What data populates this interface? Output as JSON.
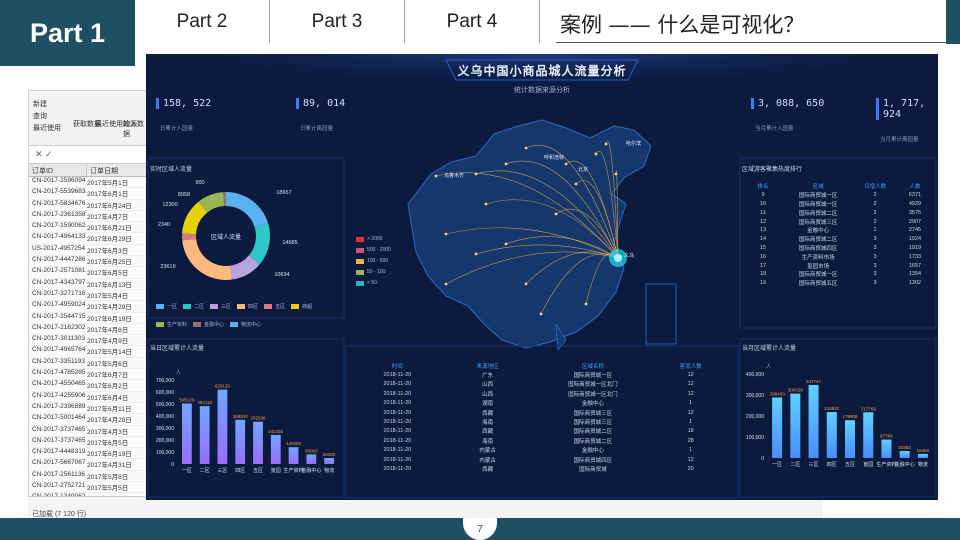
{
  "nav": {
    "part1": "Part 1",
    "part2": "Part 2",
    "part3": "Part 3",
    "part4": "Part 4",
    "slide_title": "案例 —— 什么是可视化？",
    "page_number": "7"
  },
  "excel": {
    "ribbon_items": [
      "新建",
      "查询",
      "最近使用",
      "获取数据",
      "最近使用的源",
      "输入数据"
    ],
    "col_headers": [
      "订单ID",
      "订单日期"
    ],
    "rows": [
      [
        "CN-2017-2596094",
        "2017年5月1日"
      ],
      [
        "CN-2017-5539683",
        "2017年6月1日"
      ],
      [
        "CN-2017-5834676",
        "2017年6月24日"
      ],
      [
        "CN-2017-2361358",
        "2017年4月7日"
      ],
      [
        "CN-2017-1590062",
        "2017年6月21日"
      ],
      [
        "CN-2017-4964133",
        "2017年6月29日"
      ],
      [
        "US-2017-4957254",
        "2017年6月3日"
      ],
      [
        "CN-2017-4447286",
        "2017年6月25日"
      ],
      [
        "CN-2017-2571081",
        "2017年6月5日"
      ],
      [
        "CN-2017-4343797",
        "2017年6月13日"
      ],
      [
        "CN-2017-3271716",
        "2017年5月4日"
      ],
      [
        "CN-2017-4959024",
        "2017年4月29日"
      ],
      [
        "CN-2017-2544715",
        "2017年6月19日"
      ],
      [
        "CN-2017-2162302",
        "2017年4月8日"
      ],
      [
        "CN-2017-3011303",
        "2017年4月9日"
      ],
      [
        "CN-2017-4965764",
        "2017年5月14日"
      ],
      [
        "CN-2017-3351193",
        "2017年5月6日"
      ],
      [
        "CN-2017-4785285",
        "2017年6月7日"
      ],
      [
        "CN-2017-4550465",
        "2017年6月2日"
      ],
      [
        "CN-2017-4255906",
        "2017年6月4日"
      ],
      [
        "CN-2017-2396889",
        "2017年6月11日"
      ],
      [
        "CN-2017-5001464",
        "2017年4月28日"
      ],
      [
        "CN-2017-3737465",
        "2017年4月3日"
      ],
      [
        "CN-2017-3737465",
        "2017年6月5日"
      ],
      [
        "CN-2017-4448319",
        "2017年6月19日"
      ],
      [
        "CN-2017-5667067",
        "2017年4月31日"
      ],
      [
        "CN-2017-2561136",
        "2017年5月8日"
      ],
      [
        "CN-2017-2752721",
        "2017年5月5日"
      ],
      [
        "CN-2017-1349062",
        "2017年5月26日"
      ],
      [
        "CN-2017-4256405",
        "2017年5月25日"
      ]
    ],
    "status": "已加载 (7 120 行)"
  },
  "dashboard": {
    "title": "义乌中国小商品城人流量分析",
    "subtitle": "统计数据来源分析",
    "kpis": [
      {
        "value": "158, 522",
        "label": "日累计入园量"
      },
      {
        "value": "89, 014",
        "label": "日累计离园量"
      },
      {
        "value": "3, 088, 650",
        "label": "当月累计入园量"
      },
      {
        "value": "1, 717, 924",
        "label": "当月累计离园量"
      }
    ],
    "donut": {
      "title": "实时区域人流量",
      "center": "区域人流量",
      "labels": [
        "900",
        "8958",
        "12300",
        "2340",
        "23619",
        "18657",
        "14685",
        "10634"
      ],
      "segment_colors": [
        "#5ab1ef",
        "#2ec7c9",
        "#b6a2de",
        "#ffb980",
        "#d87a80",
        "#e5cf0d",
        "#97b552",
        "#95706d"
      ],
      "segment_values": [
        18657,
        14685,
        10634,
        23619,
        2340,
        12300,
        8958,
        900
      ],
      "legend": [
        "一区",
        "二区",
        "三区",
        "四区",
        "五区",
        "商超",
        "生产资料",
        "金融中心",
        "物流中心"
      ]
    },
    "map_legend": [
      {
        "label": "> 2000",
        "color": "#e5323e"
      },
      {
        "label": "500 - 2000",
        "color": "#d0557d"
      },
      {
        "label": "100 - 500",
        "color": "#e7b54a"
      },
      {
        "label": "50 - 100",
        "color": "#8fbd53"
      },
      {
        "label": "< 50",
        "color": "#24b2c6"
      }
    ],
    "ranking": {
      "title": "区域游客聚集热度排行",
      "headers": [
        "排名",
        "区域",
        "日增人数",
        "人数"
      ],
      "rows": [
        [
          "9",
          "国际商贸城一区",
          "2",
          "6371"
        ],
        [
          "10",
          "国际商贸城一区",
          "2",
          "4929"
        ],
        [
          "11",
          "国际商贸城二区",
          "2",
          "3575"
        ],
        [
          "12",
          "国际商贸城三区",
          "2",
          "2907"
        ],
        [
          "13",
          "金融中心",
          "1",
          "2745"
        ],
        [
          "14",
          "国际商贸城二区",
          "3",
          "1924"
        ],
        [
          "15",
          "国际商贸城四区",
          "3",
          "1919"
        ],
        [
          "16",
          "生产资料市场",
          "3",
          "1733"
        ],
        [
          "17",
          "篁园市场",
          "3",
          "1657"
        ],
        [
          "18",
          "国际商贸城一区",
          "3",
          "1354"
        ],
        [
          "19",
          "国际商贸城五区",
          "3",
          "1302"
        ]
      ]
    },
    "middle_table": {
      "headers": [
        "时间",
        "来源地区",
        "区域名称",
        "客流人数"
      ],
      "rows": [
        [
          "2018-11-20",
          "广东",
          "国际商贸城一区",
          "12"
        ],
        [
          "2018-11-20",
          "山西",
          "国际商贸城一区北门",
          "12"
        ],
        [
          "2018-11-20",
          "山西",
          "国际商贸城一区北门",
          "12"
        ],
        [
          "2018-11-20",
          "湖南",
          "金融中心",
          "1"
        ],
        [
          "2018-11-20",
          "西藏",
          "国际商贸城三区",
          "12"
        ],
        [
          "2018-11-20",
          "海南",
          "国际商贸城三区",
          "1"
        ],
        [
          "2018-11-20",
          "西藏",
          "国际商贸城二区",
          "18"
        ],
        [
          "2018-11-20",
          "海南",
          "国际商贸城二区",
          "28"
        ],
        [
          "2018-11-20",
          "内蒙古",
          "金融中心",
          "1"
        ],
        [
          "2018-11-20",
          "内蒙古",
          "国际商贸城四区",
          "12"
        ],
        [
          "2018-11-20",
          "西藏",
          "国际商贸城",
          "20"
        ]
      ]
    },
    "left_bar": {
      "title": "当日区域累计人流量",
      "unit": "人",
      "y_ticks": [
        "700,000",
        "600,000",
        "500,000",
        "400,000",
        "300,000",
        "200,000",
        "100,000",
        "0"
      ],
      "categories": [
        "一区",
        "二区",
        "三区",
        "四区",
        "五区",
        "篁园",
        "生产资料",
        "金融中心",
        "物流"
      ],
      "values": [
        505129,
        482110,
        620129,
        368530,
        352536,
        242450,
        140000,
        80000,
        50000
      ],
      "labels": [
        "505129",
        "482110",
        "620129",
        "368530",
        "352536",
        "242450",
        "140000",
        "80000",
        "50000"
      ]
    },
    "right_bar": {
      "title": "当月区域累计人流量",
      "unit": "人",
      "y_ticks": [
        "400,000",
        "300,000",
        "200,000",
        "100,000",
        "0"
      ],
      "categories": [
        "一区",
        "二区",
        "三区",
        "四区",
        "五区",
        "篁园",
        "生产资料",
        "金融中心",
        "物流"
      ],
      "values": [
        288450,
        306658,
        347747,
        218922,
        179906,
        217769,
        87784,
        33383,
        19450
      ],
      "labels": [
        "288450",
        "306658",
        "347747",
        "218922",
        "179906",
        "217769",
        "87784",
        "33383",
        "19450"
      ]
    },
    "cities": [
      "乌鲁木齐",
      "北京",
      "哈尔滨",
      "呼和浩特",
      "义乌"
    ]
  }
}
